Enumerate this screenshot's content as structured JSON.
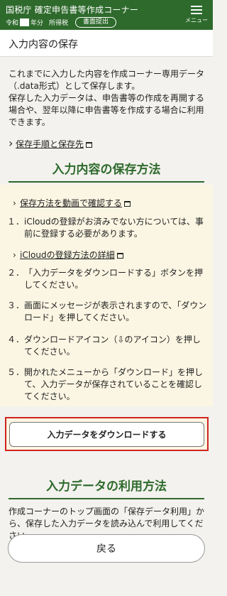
{
  "header": {
    "title": "国税庁 確定申告書等作成コーナー",
    "era_prefix": "令和",
    "era_suffix": "年分",
    "tax_type": "所得税",
    "submit_label": "書面提出",
    "menu_label": "メニュー"
  },
  "page": {
    "title": "入力内容の保存"
  },
  "intro": {
    "paragraph1": "これまでに入力した内容を作成コーナー専用データ（.data形式）として保存します。",
    "paragraph2": "保存した入力データは、申告書等の作成を再開する場合や、翌年以降に申告書等を作成する場合に利用できます。",
    "link_procedure": "保存手順と保存先"
  },
  "save_section": {
    "title": "入力内容の保存方法",
    "link_video": "保存方法を動画で確認する",
    "step1_num": "１．",
    "step1_text": "iCloudの登録がお済みでない方については、事前に登録する必要があります。",
    "link_icloud": "iCloudの登録方法の詳細",
    "step2_num": "２．",
    "step2_text": "「入力データをダウンロードする」ボタンを押してください。",
    "step3_num": "３．",
    "step3_text": "画面にメッセージが表示されますので、「ダウンロード」を押してください。",
    "step4_num": "４．",
    "step4_text": "ダウンロードアイコン（⇩のアイコン）を押してください。",
    "step5_num": "５．",
    "step5_text": "開かれたメニューから「ダウンロード」を押して、入力データが保存されていることを確認してください。",
    "download_button": "入力データをダウンロードする"
  },
  "usage_section": {
    "title": "入力データの利用方法",
    "text": "作成コーナーのトップ画面の「保存データ利用」から、保存した入力データを読み込んで利用してください。"
  },
  "back_button": "戻る",
  "colors": {
    "brand_green": "#2e6a2c",
    "highlight_red": "#d0241f",
    "steps_bg": "#fbf6e3"
  }
}
